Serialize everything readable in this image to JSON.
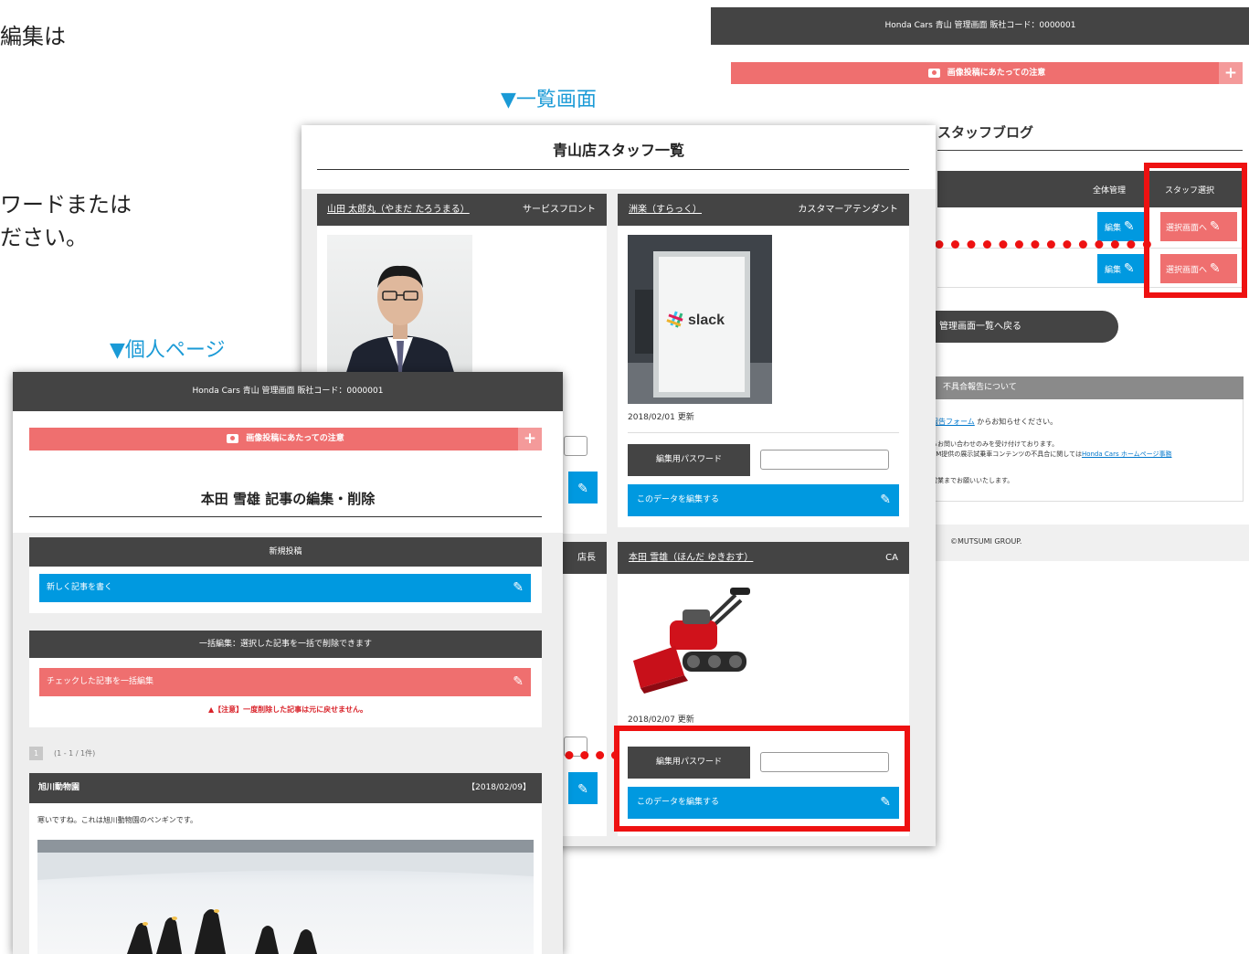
{
  "bg_text": {
    "line1": "編集は",
    "line2": "ワードまたは",
    "line3": "ださい。"
  },
  "callouts": {
    "list_screen": "▼一覧画面",
    "personal_page": "▼個人ページ"
  },
  "admin": {
    "header": "Honda Cars 青山 管理画面  販社コード：0000001",
    "notice": "画像投稿にあたっての注意",
    "blog_title": "スタッフブログ",
    "col_all": "全体管理",
    "col_staff": "スタッフ選択",
    "edit_btn": "編集",
    "select_btn": "選択画面へ",
    "back_btn": "管理画面一覧へ戻る",
    "defect_header": "不具合報告について",
    "defect_link": "報告フォーム",
    "defect_line1_rest": " からお知らせください。",
    "defect_line2": "るお問い合わせのみを受け付けております。",
    "defect_line3_pre": "HM提供の展示試乗車コンテンツの不具合に関しては",
    "defect_line3_link": "Honda Cars ホームページ事務",
    "defect_line4": "営業までお願いいたします。",
    "footer": "©MUTSUMI GROUP."
  },
  "list": {
    "title": "青山店スタッフ一覧",
    "staff": [
      {
        "name": "山田 太郎丸（やまだ たろうまる）",
        "role": "サービスフロント"
      },
      {
        "name": "洲楽（すらっく）",
        "role": "カスタマーアテンダント",
        "updated": "2018/02/01 更新"
      },
      {
        "role": "店長"
      },
      {
        "name": "本田 雪雄（ほんだ ゆきおす）",
        "role": "CA",
        "updated": "2018/02/07 更新"
      }
    ],
    "pw_label": "編集用パスワード",
    "edit_data_btn": "このデータを編集する",
    "slack_text": "slack"
  },
  "personal": {
    "header": "Honda Cars 青山 管理画面  販社コード：0000001",
    "notice": "画像投稿にあたっての注意",
    "title": "本田 雪雄 記事の編集・削除",
    "new_post_header": "新規投稿",
    "new_post_btn": "新しく記事を書く",
    "bulk_header": "一括編集：選択した記事を一括で削除できます",
    "bulk_btn": "チェックした記事を一括編集",
    "warning": "▲【注意】一度削除した記事は元に戻せません。",
    "page_num": "1",
    "page_info": "(1 - 1 / 1件)",
    "article_title": "旭川動物園",
    "article_date": "【2018/02/09】",
    "article_body": "寒いですね。これは旭川動物園のペンギンです。"
  },
  "icons": {
    "pencil": "✎",
    "plus": "+"
  },
  "colors": {
    "dark": "#444444",
    "pink": "#ef6f6f",
    "blue": "#0099e0",
    "red_annotation": "#ee1111",
    "callout_blue": "#1a9ad6"
  }
}
